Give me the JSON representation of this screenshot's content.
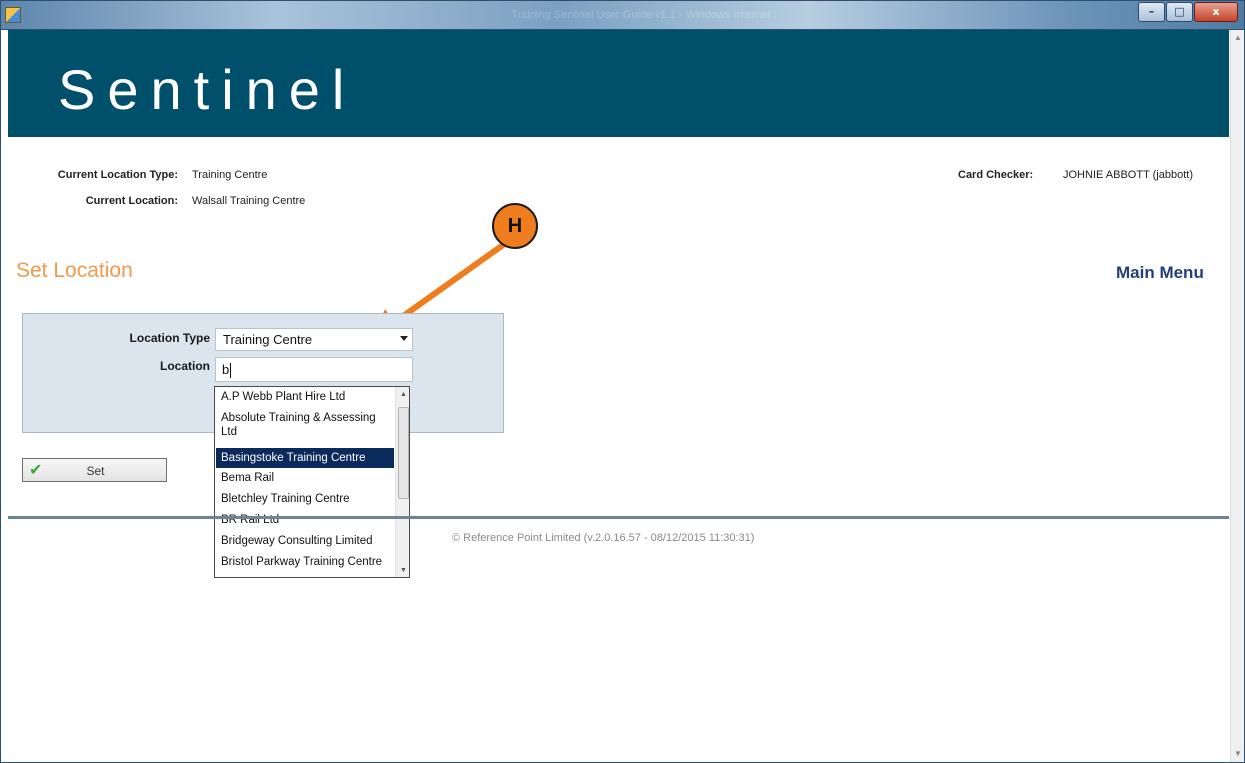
{
  "window": {
    "title": "Training Sentinel User Guide v1.1 - Windows Internet",
    "buttons": {
      "minimize": "–",
      "maximize": "□",
      "close": "x"
    }
  },
  "banner": {
    "title": "Sentinel"
  },
  "info": {
    "location_type_label": "Current Location Type:",
    "location_type_value": "Training Centre",
    "location_label": "Current Location:",
    "location_value": "Walsall Training Centre",
    "card_checker_label": "Card Checker:",
    "card_checker_value": "JOHNIE ABBOTT (jabbott)"
  },
  "annotation": {
    "label": "H"
  },
  "page": {
    "heading": "Set Location",
    "main_menu": "Main Menu"
  },
  "form": {
    "location_type_label": "Location Type",
    "location_type_value": "Training Centre",
    "location_label": "Location",
    "location_value": "b"
  },
  "dropdown": {
    "items": [
      {
        "label": "A.P Webb Plant Hire Ltd"
      },
      {
        "label": "Absolute Training & Assessing Ltd"
      },
      {
        "label": "Basingstoke Training Centre",
        "selected": true
      },
      {
        "label": "Bema Rail"
      },
      {
        "label": "Bletchley Training Centre"
      },
      {
        "label": "BR Rail Ltd"
      },
      {
        "label": "Bridgeway Consulting Limited"
      },
      {
        "label": "Bristol Parkway Training Centre"
      }
    ]
  },
  "actions": {
    "set_label": "Set"
  },
  "footer": {
    "text": "© Reference Point Limited (v.2.0.16.57 - 08/12/2015 11:30:31)"
  },
  "colors": {
    "banner": "#00506b",
    "heading": "#f1994a",
    "main_menu": "#213f7b",
    "badge": "#f07d1d",
    "selected_item": "#0b2a5c"
  },
  "icons": {
    "set_button": "checkmark-icon",
    "dropdown_caret": "chevron-down-icon"
  }
}
